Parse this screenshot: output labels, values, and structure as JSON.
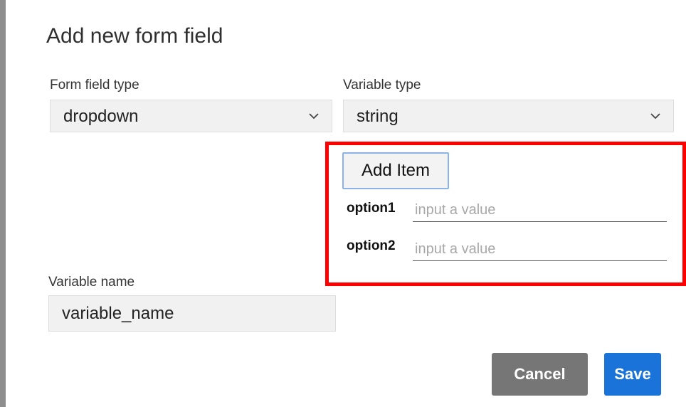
{
  "dialog": {
    "title": "Add new form field"
  },
  "form_field_type": {
    "label": "Form field type",
    "value": "dropdown",
    "icon": "chevron-down-icon"
  },
  "variable_type": {
    "label": "Variable type",
    "value": "string",
    "icon": "chevron-down-icon"
  },
  "options": {
    "add_item_label": "Add Item",
    "items": [
      {
        "label": "option1",
        "placeholder": "input a value",
        "value": ""
      },
      {
        "label": "option2",
        "placeholder": "input a value",
        "value": ""
      }
    ]
  },
  "variable_name": {
    "label": "Variable name",
    "value": "variable_name"
  },
  "actions": {
    "cancel_label": "Cancel",
    "save_label": "Save"
  },
  "colors": {
    "highlight": "#ff0000",
    "primary": "#1a73d9",
    "secondary": "#767676"
  }
}
